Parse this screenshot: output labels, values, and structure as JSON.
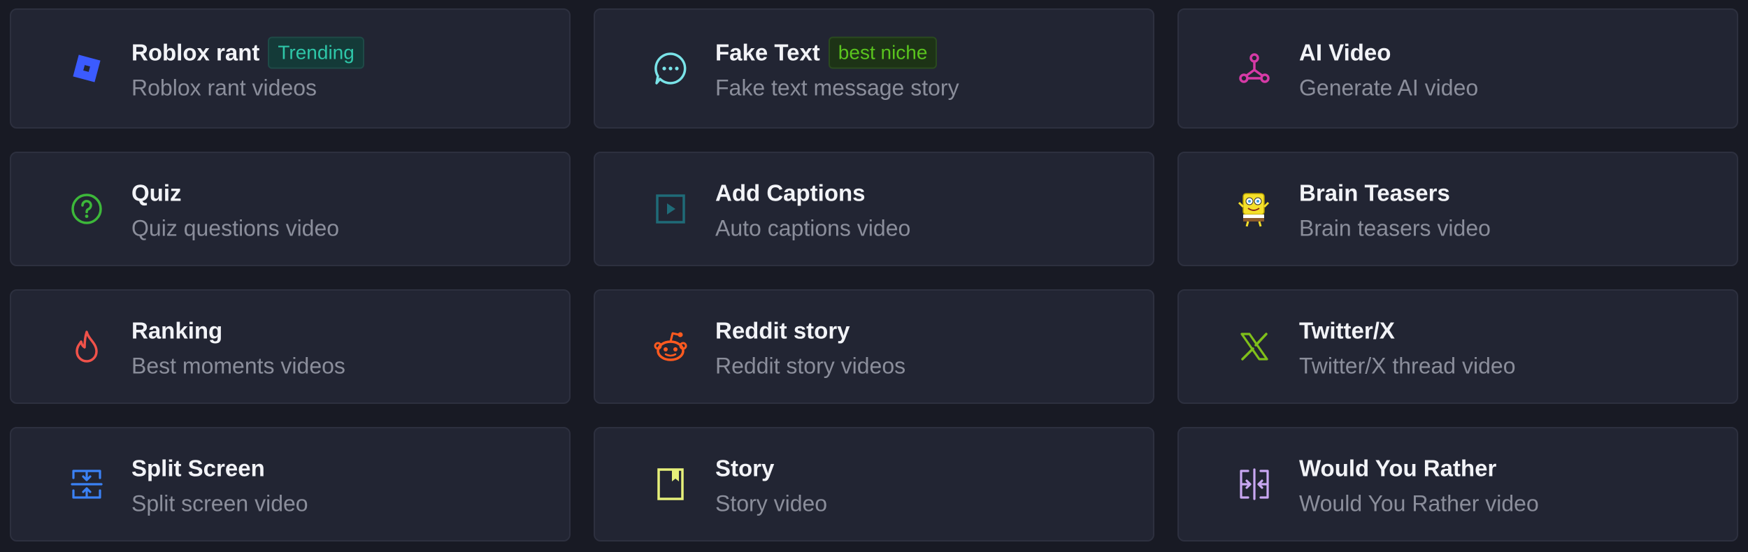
{
  "cards": [
    {
      "title": "Roblox rant",
      "badge": "Trending",
      "desc": "Roblox rant videos",
      "icon": "roblox-icon",
      "color": "#3b5bff"
    },
    {
      "title": "Fake Text",
      "badge": "best niche",
      "desc": "Fake text message story",
      "icon": "chat-bubble-icon",
      "color": "#7ae3e8"
    },
    {
      "title": "AI Video",
      "desc": "Generate AI video",
      "icon": "ai-nodes-icon",
      "color": "#d63aa6"
    },
    {
      "title": "Quiz",
      "desc": "Quiz questions video",
      "icon": "question-circle-icon",
      "color": "#3db83a"
    },
    {
      "title": "Add Captions",
      "desc": "Auto captions video",
      "icon": "play-square-icon",
      "color": "#1f6b78"
    },
    {
      "title": "Brain Teasers",
      "desc": "Brain teasers video",
      "icon": "spongebob-icon",
      "color": "#f5e02a"
    },
    {
      "title": "Ranking",
      "desc": "Best moments videos",
      "icon": "flame-icon",
      "color": "#f0524a"
    },
    {
      "title": "Reddit story",
      "desc": "Reddit story videos",
      "icon": "reddit-icon",
      "color": "#ff5a1f"
    },
    {
      "title": "Twitter/X",
      "desc": "Twitter/X thread video",
      "icon": "x-logo-icon",
      "color": "#7fbf1a"
    },
    {
      "title": "Split Screen",
      "desc": "Split screen video",
      "icon": "split-screen-icon",
      "color": "#3b82f6"
    },
    {
      "title": "Story",
      "desc": "Story video",
      "icon": "bookmark-icon",
      "color": "#e6f07a"
    },
    {
      "title": "Would You Rather",
      "desc": "Would You Rather video",
      "icon": "split-arrows-icon",
      "color": "#c9a7f2"
    }
  ]
}
